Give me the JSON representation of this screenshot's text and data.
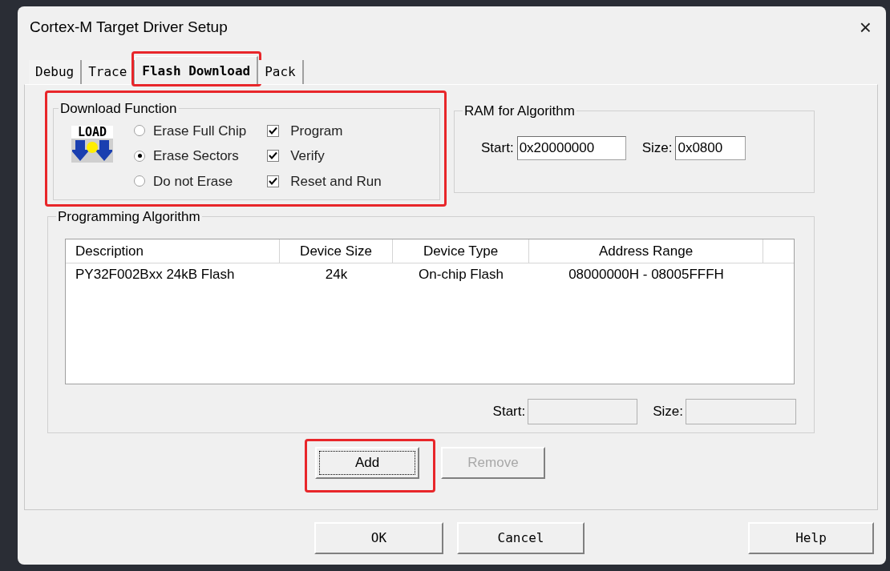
{
  "window": {
    "title": "Cortex-M Target Driver Setup",
    "close": "×"
  },
  "tabs": [
    {
      "label": "Debug",
      "selected": false,
      "highlighted": false
    },
    {
      "label": "Trace",
      "selected": false,
      "highlighted": false
    },
    {
      "label": "Flash Download",
      "selected": true,
      "highlighted": true
    },
    {
      "label": "Pack",
      "selected": false,
      "highlighted": false
    }
  ],
  "download_function": {
    "title": "Download Function",
    "highlighted": true,
    "icon_text": "LOAD",
    "erase_options": [
      {
        "label": "Erase Full Chip",
        "selected": false
      },
      {
        "label": "Erase Sectors",
        "selected": true
      },
      {
        "label": "Do not Erase",
        "selected": false
      }
    ],
    "options": [
      {
        "label": "Program",
        "checked": true
      },
      {
        "label": "Verify",
        "checked": true
      },
      {
        "label": "Reset and Run",
        "checked": true
      }
    ]
  },
  "ram": {
    "title": "RAM for Algorithm",
    "start_label": "Start:",
    "start_value": "0x20000000",
    "size_label": "Size:",
    "size_value": "0x0800"
  },
  "algorithm": {
    "title": "Programming Algorithm",
    "columns": [
      "Description",
      "Device Size",
      "Device Type",
      "Address Range"
    ],
    "rows": [
      [
        "PY32F002Bxx 24kB Flash",
        "24k",
        "On-chip Flash",
        "08000000H - 08005FFFH"
      ]
    ],
    "start_label": "Start:",
    "size_label": "Size:"
  },
  "list_buttons": [
    {
      "label": "Add",
      "disabled": false,
      "focused": true,
      "highlighted": true
    },
    {
      "label": "Remove",
      "disabled": true,
      "focused": false,
      "highlighted": false
    }
  ],
  "dialog_buttons": [
    "OK",
    "Cancel",
    "Help"
  ]
}
